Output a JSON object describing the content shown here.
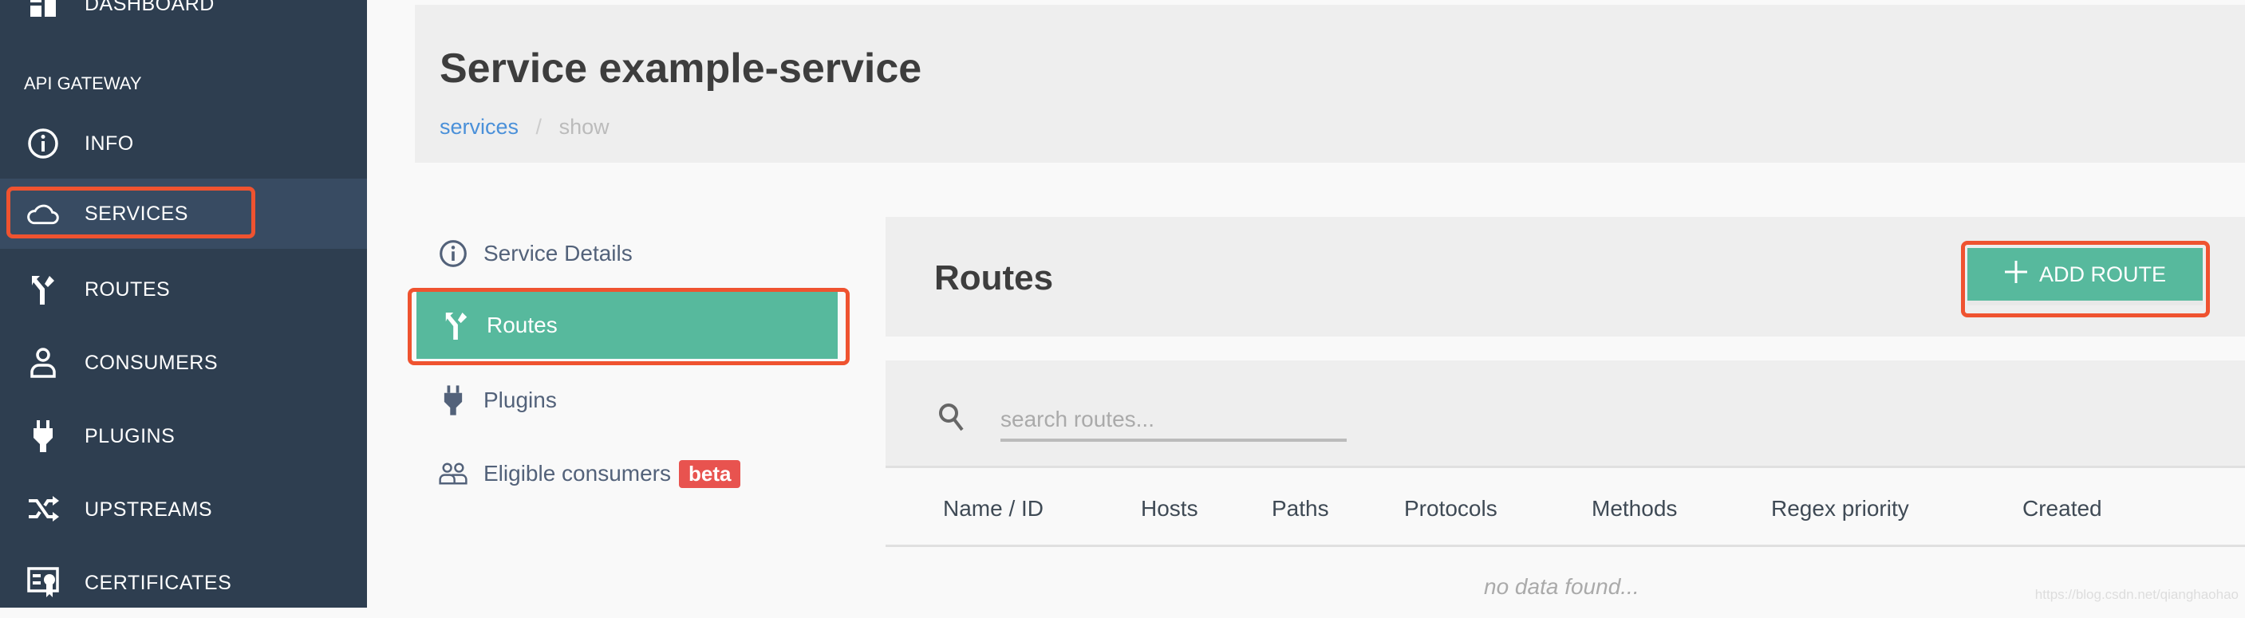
{
  "sidebar": {
    "section": "API GATEWAY",
    "items": [
      {
        "label": "DASHBOARD",
        "icon": "dashboard-icon"
      },
      {
        "label": "INFO",
        "icon": "info-icon"
      },
      {
        "label": "SERVICES",
        "icon": "cloud-icon",
        "active": true
      },
      {
        "label": "ROUTES",
        "icon": "routes-icon"
      },
      {
        "label": "CONSUMERS",
        "icon": "user-icon"
      },
      {
        "label": "PLUGINS",
        "icon": "plug-icon"
      },
      {
        "label": "UPSTREAMS",
        "icon": "shuffle-icon"
      },
      {
        "label": "CERTIFICATES",
        "icon": "certificate-icon"
      }
    ]
  },
  "header": {
    "title": "Service example-service",
    "breadcrumb": [
      "services",
      "show"
    ],
    "separator": "/"
  },
  "subnav": {
    "items": [
      {
        "label": "Service Details",
        "icon": "info-icon"
      },
      {
        "label": "Routes",
        "icon": "routes-icon",
        "active": true
      },
      {
        "label": "Plugins",
        "icon": "plug-icon"
      },
      {
        "label": "Eligible consumers",
        "icon": "users-icon",
        "badge": "beta"
      }
    ]
  },
  "routes": {
    "title": "Routes",
    "add_button": "ADD ROUTE",
    "search_placeholder": "search routes...",
    "columns": [
      "Name / ID",
      "Hosts",
      "Paths",
      "Protocols",
      "Methods",
      "Regex priority",
      "Created"
    ],
    "empty": "no data found..."
  },
  "colors": {
    "sidebar": "#2e3e50",
    "accent": "#57b99d",
    "highlight": "#ef5330",
    "badge": "#e8534f",
    "link": "#4a90d9"
  },
  "watermark": "https://blog.csdn.net/qianghaohao"
}
